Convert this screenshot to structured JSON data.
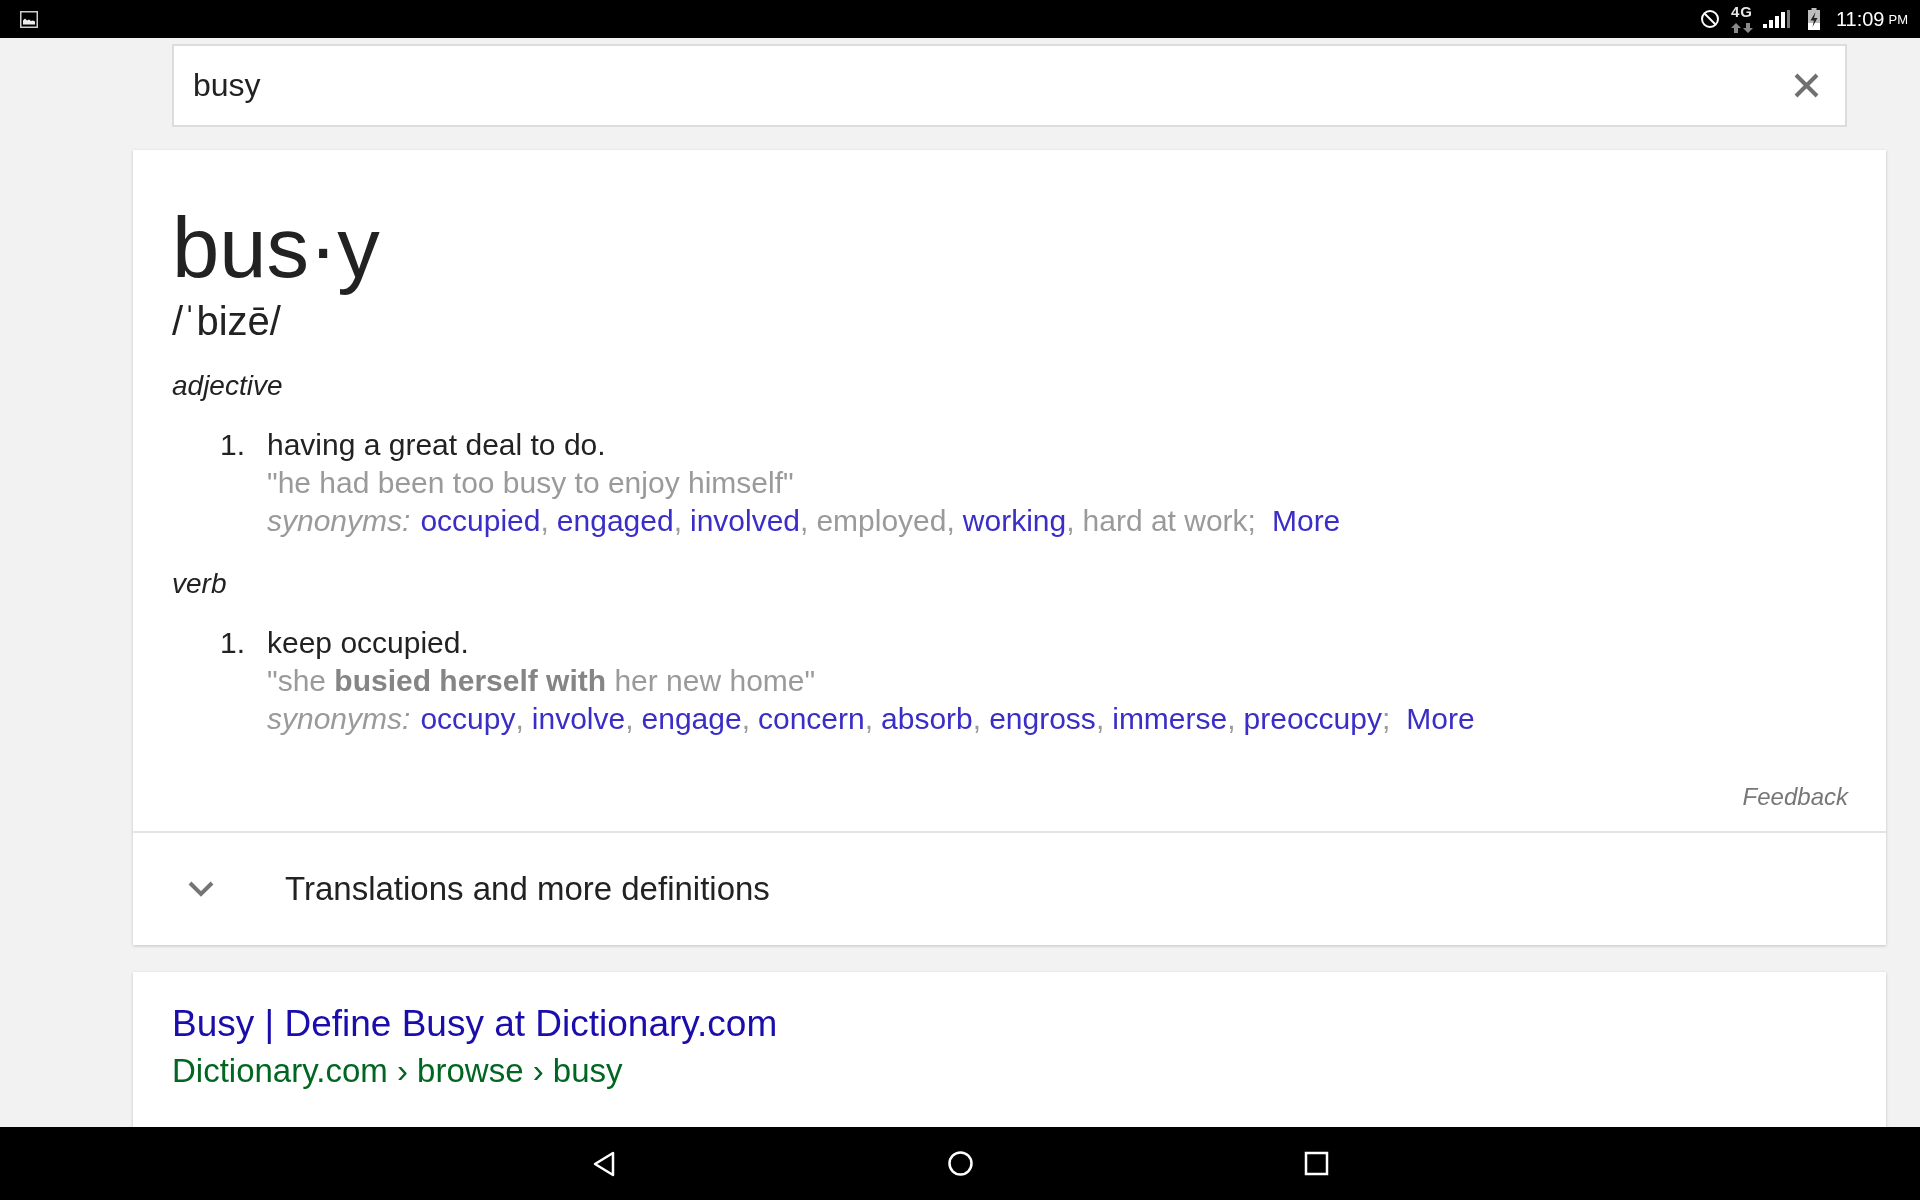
{
  "status_bar": {
    "network": "4G",
    "time": "11:09",
    "period": "PM"
  },
  "search": {
    "value": "busy"
  },
  "dictionary": {
    "headword": "bus·y",
    "pronunciation": "/ˈbizē/",
    "senses": [
      {
        "part_of_speech": "adjective",
        "definitions": [
          {
            "number": "1.",
            "text": "having a great deal to do.",
            "example": "\"he had been too busy to enjoy himself\"",
            "synonyms_label": "synonyms:",
            "synonyms": [
              {
                "word": "occupied",
                "link": true,
                "separator": ","
              },
              {
                "word": "engaged",
                "link": true,
                "separator": ","
              },
              {
                "word": "involved",
                "link": true,
                "separator": ","
              },
              {
                "word": "employed",
                "link": false,
                "separator": ","
              },
              {
                "word": "working",
                "link": true,
                "separator": ","
              },
              {
                "word": "hard at work",
                "link": false,
                "separator": ";"
              }
            ],
            "more": "More"
          }
        ]
      },
      {
        "part_of_speech": "verb",
        "definitions": [
          {
            "number": "1.",
            "text": "keep occupied.",
            "example": "\"she **busied herself with** her new home\"",
            "synonyms_label": "synonyms:",
            "synonyms": [
              {
                "word": "occupy",
                "link": true,
                "separator": ","
              },
              {
                "word": "involve",
                "link": true,
                "separator": ","
              },
              {
                "word": "engage",
                "link": true,
                "separator": ","
              },
              {
                "word": "concern",
                "link": true,
                "separator": ","
              },
              {
                "word": "absorb",
                "link": true,
                "separator": ","
              },
              {
                "word": "engross",
                "link": true,
                "separator": ","
              },
              {
                "word": "immerse",
                "link": true,
                "separator": ","
              },
              {
                "word": "preoccupy",
                "link": true,
                "separator": ";"
              }
            ],
            "more": "More"
          }
        ]
      }
    ],
    "feedback": "Feedback",
    "more_section": {
      "label": "Translations and more definitions",
      "expanded": false
    }
  },
  "results": [
    {
      "title": "Busy | Define Busy at Dictionary.com",
      "breadcrumb": "Dictionary.com › browse › busy"
    }
  ]
}
